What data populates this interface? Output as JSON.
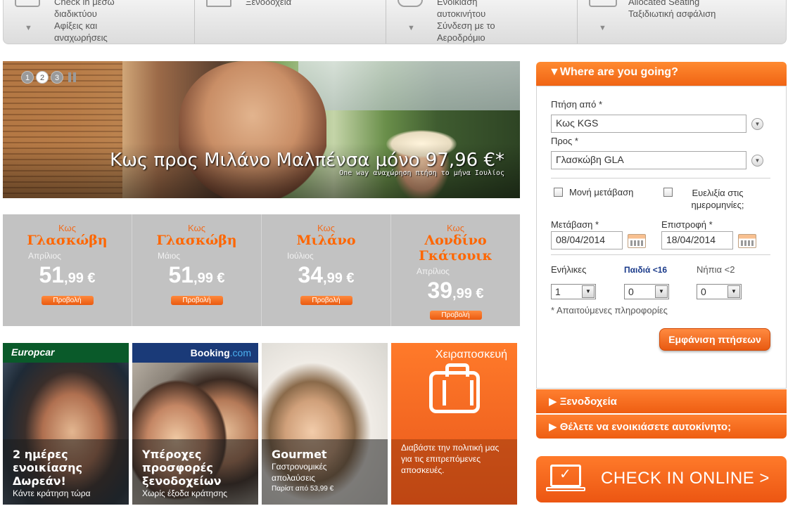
{
  "topnav": {
    "cols": [
      {
        "lines": [
          "Check in μέσω",
          "διαδικτύου",
          "Αφίξεις και",
          "αναχωρήσεις"
        ],
        "arrow": "▼"
      },
      {
        "lines": [
          "Ξενοδοχεία"
        ],
        "arrow": ""
      },
      {
        "lines": [
          "Ενοικίαση",
          "αυτοκινήτου",
          "Σύνδεση με το",
          "Αεροδρόμιο"
        ],
        "arrow": "▼"
      },
      {
        "lines": [
          "Allocated Seating",
          "Ταξιδιωτική ασφάλιση"
        ],
        "arrow": "▼"
      }
    ]
  },
  "hero": {
    "caption": "Κως προς Μιλάνο Μαλπένσα μόνο 97,96 €*",
    "sub": "One way αναχώρηση πτήση το μήνα Ιουλίος",
    "dots": [
      "1",
      "2",
      "3"
    ]
  },
  "deals": [
    {
      "from": "Κως",
      "to": "Γλασκώβη",
      "month": "Απρίλιος",
      "int": "51",
      "dec": ",99",
      "cur": "€",
      "btn": "Προβολή"
    },
    {
      "from": "Κως",
      "to": "Γλασκώβη",
      "month": "Μάιος",
      "int": "51",
      "dec": ",99",
      "cur": "€",
      "btn": "Προβολή"
    },
    {
      "from": "Κως",
      "to": "Μιλάνο",
      "month": "Ιούλιος",
      "int": "34",
      "dec": ",99",
      "cur": "€",
      "btn": "Προβολή"
    },
    {
      "from": "Κως",
      "to": "Λονδίνο Γκάτουικ",
      "month": "Απρίλιος",
      "int": "39",
      "dec": ",99",
      "cur": "€",
      "btn": "Προβολή"
    }
  ],
  "tiles": {
    "europcar": {
      "brand": "Europcar",
      "h": "2 ημέρες ενοικίασης Δωρεάν!",
      "s": "Κάντε κράτηση τώρα"
    },
    "booking": {
      "brand1": "Booking",
      "brand2": ".com",
      "h": "Υπέροχες προσφορές ξενοδοχείων",
      "s": "Χωρίς έξοδα κράτησης"
    },
    "gourmet": {
      "h": "Gourmet",
      "s1": "Γαστρονομικές",
      "s2": "απολαύσεις",
      "s3": "Παρίστ από 53,99 €"
    },
    "baggage": {
      "title": "Χειραποσκευή",
      "s": "Διαβάστε την πολιτική μας για τις επιτρεπόμενες αποσκευές."
    }
  },
  "search": {
    "title": "▼Where are you going?",
    "from_label": "Πτήση από *",
    "from_value": "Κως KGS",
    "to_label": "Προς *",
    "to_value": "Γλασκώβη GLA",
    "oneway": "Μονή μετάβαση",
    "flex": "Ευελιξία στις ημερομηνίες;",
    "depart_label": "Μετάβαση *",
    "depart_value": "08/04/2014",
    "return_label": "Επιστροφή *",
    "return_value": "18/04/2014",
    "adults_label": "Ενήλικες",
    "children_label": "Παιδιά <16",
    "infants_label": "Νήπια <2",
    "adults_value": "1",
    "children_value": "0",
    "infants_value": "0",
    "required": "* Απαιτούμενες πληροφορίες",
    "button": "Εμφάνιση πτήσεων",
    "hotels": "▶ Ξενοδοχεία",
    "car": "▶ Θέλετε να ενοικιάσετε αυτοκίνητο;"
  },
  "checkin": {
    "label": "CHECK IN ONLINE >"
  },
  "colors": {
    "accent": "#f26a1b",
    "deal_bg": "#c2c2c2",
    "booking_blue": "#1a3a78",
    "europcar_green": "#0a5a2a"
  }
}
